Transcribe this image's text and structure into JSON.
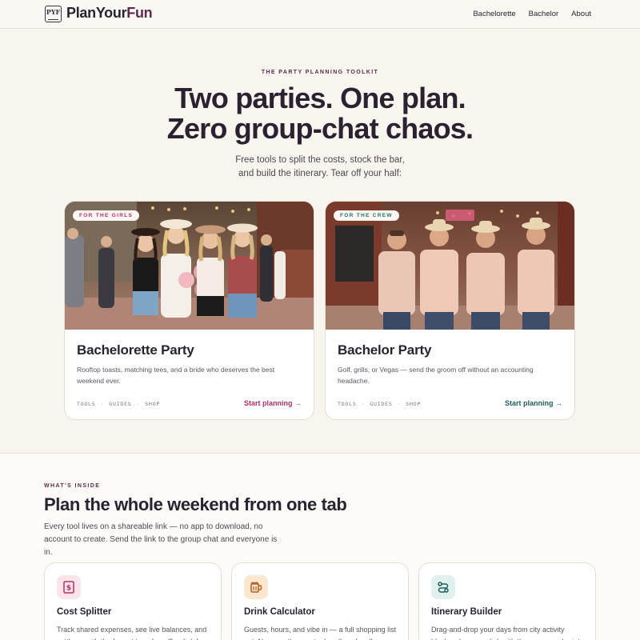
{
  "brand": {
    "mark": "PYF",
    "name_part1": "PlanYour",
    "name_part2": "Fun"
  },
  "nav": {
    "items": [
      "Bachelorette",
      "Bachelor",
      "About"
    ]
  },
  "hero": {
    "eyebrow": "THE PARTY PLANNING TOOLKIT",
    "title_line1": "Two parties. One plan.",
    "title_line2": "Zero group-chat chaos.",
    "subtitle_line1": "Free tools to split the costs, stock the bar,",
    "subtitle_line2": "and build the itinerary. Tear off your half:"
  },
  "cards": [
    {
      "tag": "FOR THE GIRLS",
      "title": "Bachelorette Party",
      "description": "Rooftop toasts, matching tees, and a bride who deserves the best weekend ever.",
      "links": [
        "TOOLS",
        "GUIDES",
        "SHOP"
      ],
      "cta": "Start planning →",
      "accent": "#b4306a"
    },
    {
      "tag": "FOR THE CREW",
      "title": "Bachelor Party",
      "description": "Golf, grills, or Vegas — send the groom off without an accounting headache.",
      "links": [
        "TOOLS",
        "GUIDES",
        "SHOP"
      ],
      "cta": "Start planning →",
      "accent": "#1e5f5c"
    }
  ],
  "inside": {
    "eyebrow": "WHAT'S INSIDE",
    "title": "Plan the whole weekend from one tab",
    "subtitle_line1": "Every tool lives on a shareable link — no app to download, no",
    "subtitle_line2": "account to create. Send the link to the group chat and everyone is in."
  },
  "tools": [
    {
      "icon": "dollar-receipt-icon",
      "name": "Cost Splitter",
      "description": "Track shared expenses, see live balances, and settle up with the fewest transfers. One link for"
    },
    {
      "icon": "beer-mug-icon",
      "name": "Drink Calculator",
      "description": "Guests, hours, and vibe in — a full shopping list out. No more three extra handles of vodka."
    },
    {
      "icon": "route-icon",
      "name": "Itinerary Builder",
      "description": "Drag-and-drop your days from city activity blocks, share one link with the group, and print"
    }
  ],
  "colors": {
    "background": "#f8f5ee",
    "brand": "#5b2a4e",
    "bachelorette_accent": "#b4306a",
    "bachelor_accent": "#1e5f5c"
  }
}
